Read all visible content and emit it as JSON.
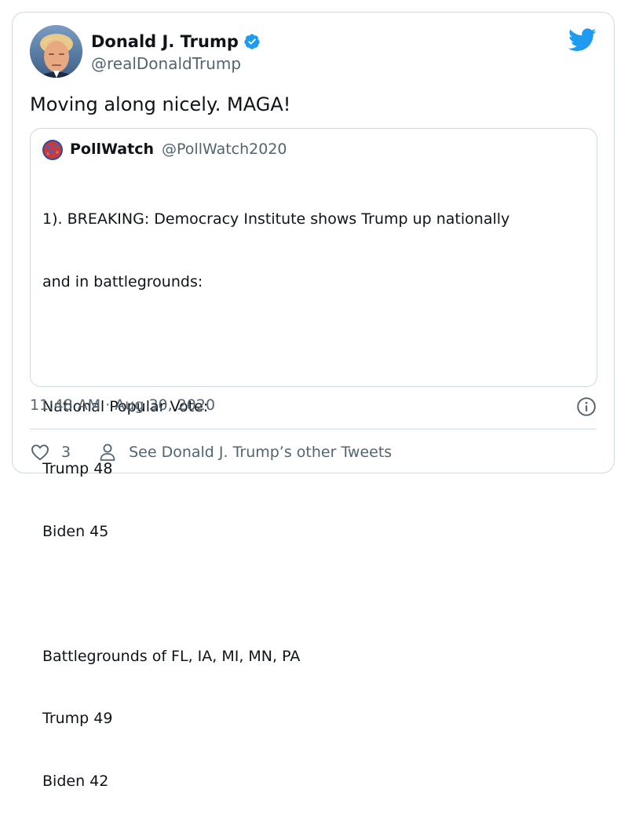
{
  "author": {
    "name": "Donald J. Trump",
    "handle": "@realDonaldTrump",
    "verified_icon": "verified-badge-icon",
    "avatar_icon": "profile-avatar"
  },
  "brand": {
    "icon": "twitter-bird-icon",
    "color": "#1d9bf0"
  },
  "tweet": {
    "text": "Moving along nicely. MAGA!"
  },
  "quoted_tweet": {
    "name": "PollWatch",
    "handle": "@PollWatch2020",
    "lines": [
      "1). BREAKING: Democracy Institute shows Trump up nationally",
      "and in battlegrounds:",
      "",
      "National Popular Vote:",
      "Trump 48",
      "Biden 45",
      "",
      "Battlegrounds of FL, IA, MI, MN, PA",
      "Trump 49",
      "Biden 42"
    ]
  },
  "meta": {
    "timestamp": "11:48 AM · Aug 30, 2020",
    "info_icon": "info-icon"
  },
  "actions": {
    "like_count": "3",
    "profile_link": "See Donald J. Trump’s other Tweets"
  },
  "colors": {
    "text": "#0f1419",
    "secondary": "#536471",
    "border": "#cfd9de",
    "verified": "#1d9bf0"
  }
}
